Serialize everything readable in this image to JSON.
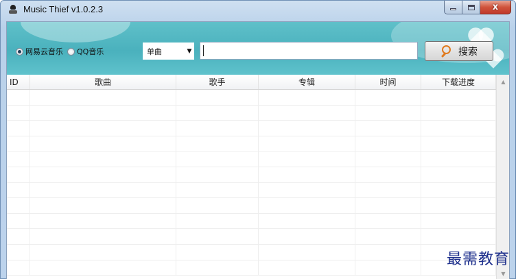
{
  "window": {
    "title": "Music Thief  v1.0.2.3",
    "controls": {
      "minimize": "minimize",
      "maximize": "maximize",
      "close": "x"
    }
  },
  "search": {
    "sources": [
      {
        "label": "网易云音乐",
        "checked": true
      },
      {
        "label": "QQ音乐",
        "checked": false
      }
    ],
    "type_selected": "单曲",
    "query": "",
    "button_label": "搜索"
  },
  "table": {
    "columns": [
      "ID",
      "歌曲",
      "歌手",
      "专辑",
      "时间",
      "下载进度"
    ],
    "empty_rows": 12
  },
  "watermark": "最需教育",
  "colors": {
    "banner": "#4ab1bd",
    "accent_icon": "#e07a1e",
    "close_button": "#c0392b"
  }
}
